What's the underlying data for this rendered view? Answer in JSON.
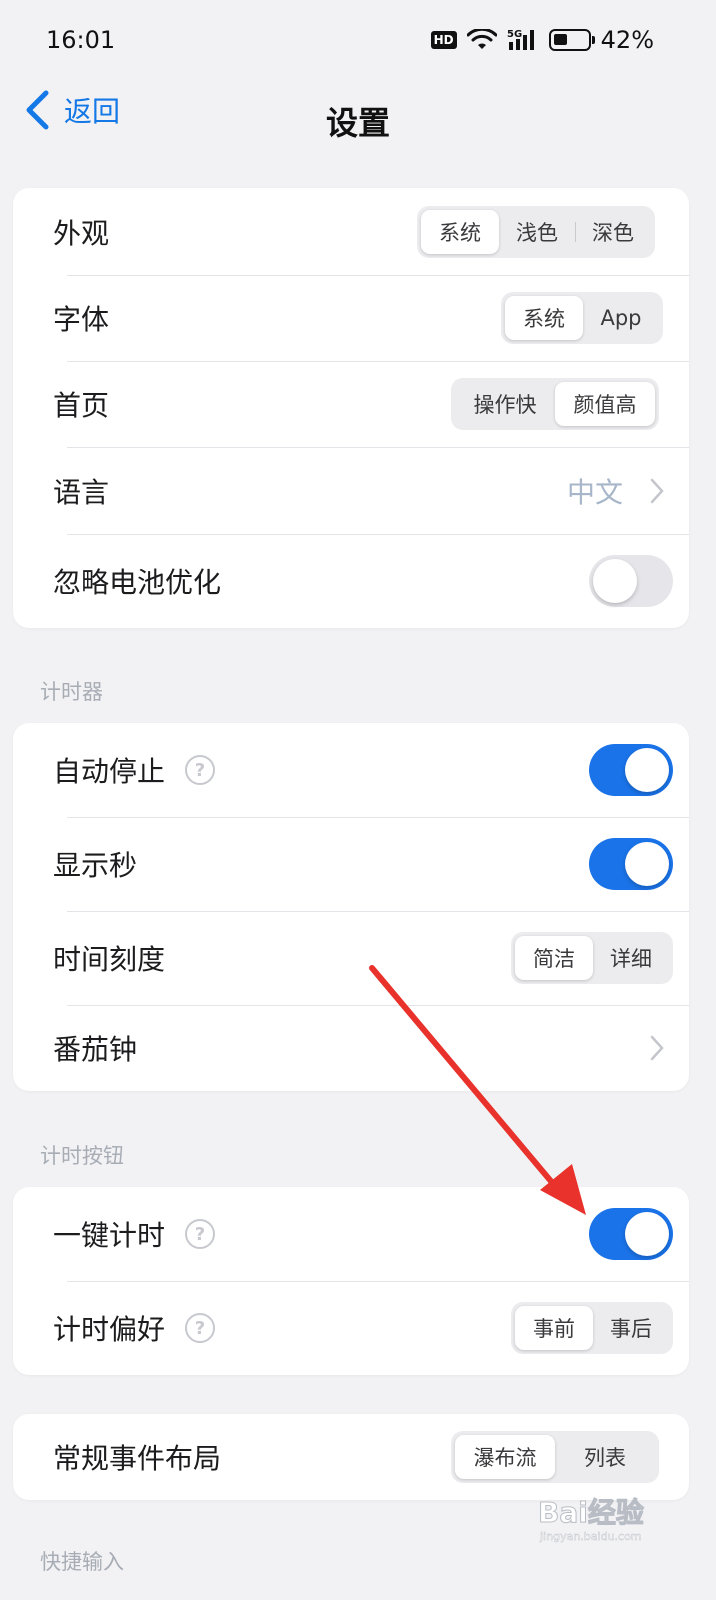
{
  "status": {
    "time": "16:01",
    "hd": "HD",
    "network": "5G",
    "battery": "42%",
    "battery_level": 0.42
  },
  "nav": {
    "back_label": "返回",
    "title": "设置"
  },
  "general": {
    "appearance": {
      "label": "外观",
      "options": [
        "系统",
        "浅色",
        "深色"
      ],
      "selected": "系统"
    },
    "font": {
      "label": "字体",
      "options": [
        "系统",
        "App"
      ],
      "selected": "系统"
    },
    "home": {
      "label": "首页",
      "options": [
        "操作快",
        "颜值高"
      ],
      "selected": "颜值高"
    },
    "language": {
      "label": "语言",
      "value": "中文"
    },
    "battery_opt": {
      "label": "忽略电池优化",
      "on": false
    }
  },
  "timer": {
    "header": "计时器",
    "auto_stop": {
      "label": "自动停止",
      "on": true
    },
    "show_seconds": {
      "label": "显示秒",
      "on": true
    },
    "time_scale": {
      "label": "时间刻度",
      "options": [
        "简洁",
        "详细"
      ],
      "selected": "简洁"
    },
    "pomodoro": {
      "label": "番茄钟"
    }
  },
  "timer_button": {
    "header": "计时按钮",
    "one_tap": {
      "label": "一键计时",
      "on": true
    },
    "preference": {
      "label": "计时偏好",
      "options": [
        "事前",
        "事后"
      ],
      "selected": "事前"
    }
  },
  "layout": {
    "event_layout": {
      "label": "常规事件布局",
      "options": [
        "瀑布流",
        "列表"
      ],
      "selected": "瀑布流"
    }
  },
  "quick_input": {
    "header": "快捷输入"
  },
  "watermark": {
    "text": "Bai经验",
    "sub": "jingyan.baidu.com"
  },
  "colors": {
    "accent": "#1a73e8",
    "arrow": "#e8322b"
  }
}
